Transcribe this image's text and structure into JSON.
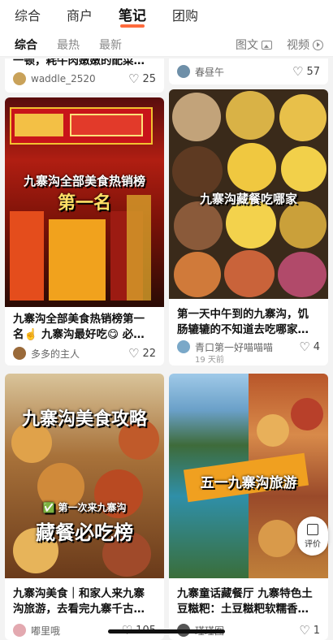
{
  "top_tabs": [
    "综合",
    "商户",
    "笔记",
    "团购"
  ],
  "sub_tabs": [
    "综合",
    "最热",
    "最新"
  ],
  "filters": {
    "image": "图文",
    "video": "视频"
  },
  "cards": [
    {
      "title": "一顿，耗牛肉嫩嫩的配菜…",
      "author": "waddle_2520",
      "likes": "25"
    },
    {
      "title": "",
      "author": "春昼午",
      "likes": "57"
    },
    {
      "overlay1": "九寨沟全部美食热销榜",
      "overlay2": "第一名",
      "title1": "九寨沟全部美食热销榜第一",
      "title2": "名☝️ 九寨沟最好吃😋 必…",
      "author": "多多的主人",
      "likes": "22"
    },
    {
      "overlay1": "九寨沟藏餐吃哪家",
      "title1": "第一天中午到的九寨沟，饥",
      "title2": "肠辘辘的不知道去吃哪家…",
      "author": "青口第一好喵喵喵",
      "time": "19 天前",
      "likes": "4"
    },
    {
      "overlay1": "九寨沟美食攻略",
      "overlay2": "✅ 第一次来九寨沟",
      "overlay3": "藏餐必吃榜",
      "title1": "九寨沟美食｜和家人来九寨",
      "title2": "沟旅游，去看完九寨千古…",
      "author": "嘟里哦",
      "likes": "105"
    },
    {
      "overlay1": "五一九寨沟旅游",
      "title1": "九寨童话藏餐厅 九寨特色土",
      "title2": "豆糍粑：土豆糍粑软糯香…",
      "author": "瑾瑾图",
      "likes": "1"
    }
  ],
  "float_button": "评价",
  "colors": {
    "accent": "#ff6b3d"
  }
}
